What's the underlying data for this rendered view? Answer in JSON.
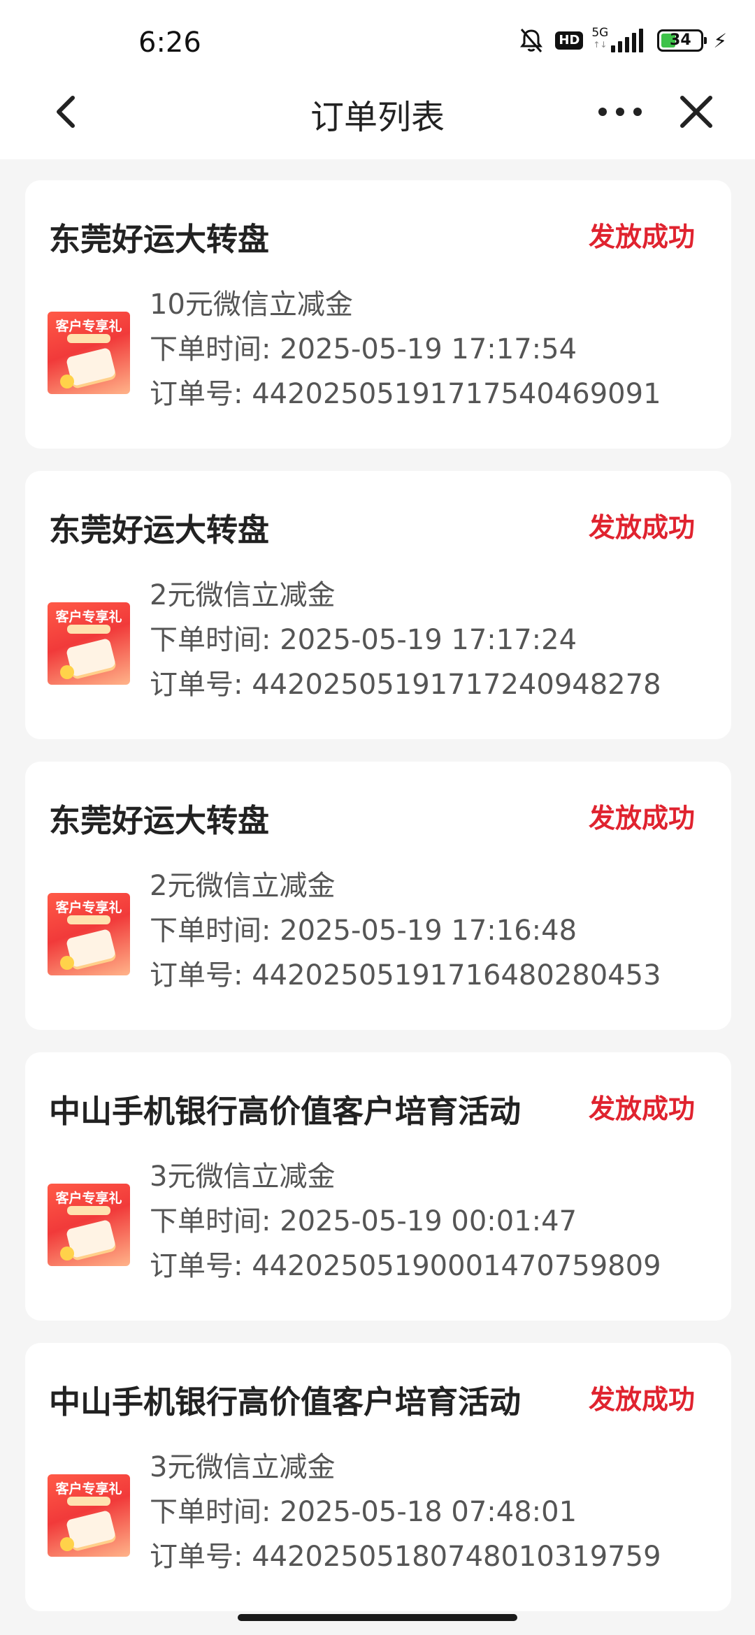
{
  "status_bar": {
    "time": "6:26",
    "network": "5G",
    "hd": "HD",
    "battery": "34"
  },
  "nav": {
    "title": "订单列表",
    "back_icon": "chevron-left-icon",
    "more_icon": "more-dots-icon",
    "close_icon": "close-icon"
  },
  "thumb_label": "客户专享礼",
  "colors": {
    "status": "#e0232f"
  },
  "orders": [
    {
      "title": "东莞好运大转盘",
      "status": "发放成功",
      "product": "10元微信立减金",
      "time": "下单时间: 2025-05-19 17:17:54",
      "order_no": "订单号: 44202505191717540469091"
    },
    {
      "title": "东莞好运大转盘",
      "status": "发放成功",
      "product": "2元微信立减金",
      "time": "下单时间: 2025-05-19 17:17:24",
      "order_no": "订单号: 44202505191717240948278"
    },
    {
      "title": "东莞好运大转盘",
      "status": "发放成功",
      "product": "2元微信立减金",
      "time": "下单时间: 2025-05-19 17:16:48",
      "order_no": "订单号: 44202505191716480280453"
    },
    {
      "title": "中山手机银行高价值客户培育活动",
      "status": "发放成功",
      "product": "3元微信立减金",
      "time": "下单时间: 2025-05-19 00:01:47",
      "order_no": "订单号: 44202505190001470759809"
    },
    {
      "title": "中山手机银行高价值客户培育活动",
      "status": "发放成功",
      "product": "3元微信立减金",
      "time": "下单时间: 2025-05-18 07:48:01",
      "order_no": "订单号: 44202505180748010319759"
    }
  ]
}
